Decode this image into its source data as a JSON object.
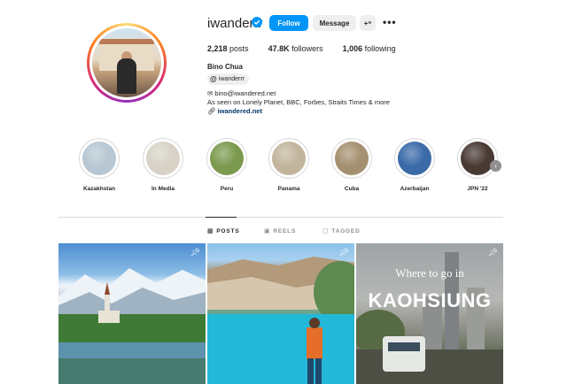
{
  "profile": {
    "username": "iwanderrr",
    "full_name": "Bino Chua",
    "threads_handle": "iwanderrr",
    "bio_email": "bino@iwandered.net",
    "bio_line2": "As seen on Lonely Planet, BBC, Forbes, Straits Times & more",
    "bio_link": "iwandered.net"
  },
  "actions": {
    "follow": "Follow",
    "message": "Message",
    "add_user": "+⁹",
    "more": "•••"
  },
  "stats": {
    "posts_count": "2,218",
    "posts_label": "posts",
    "followers_count": "47.8K",
    "followers_label": "followers",
    "following_count": "1,006",
    "following_label": "following"
  },
  "highlights": [
    {
      "label": "Kazakhstan",
      "color": "#b7c7d3"
    },
    {
      "label": "In Media",
      "color": "#d8d3c6"
    },
    {
      "label": "Peru",
      "color": "#7b9a4f"
    },
    {
      "label": "Panama",
      "color": "#c2b59c"
    },
    {
      "label": "Cuba",
      "color": "#a49070"
    },
    {
      "label": "Azerbaijan",
      "color": "#3a6aa8"
    },
    {
      "label": "JPN '22",
      "color": "#4a3a34"
    }
  ],
  "tabs": [
    {
      "label": "POSTS",
      "icon": "grid-icon",
      "glyph": "▦"
    },
    {
      "label": "REELS",
      "icon": "reels-icon",
      "glyph": "▣"
    },
    {
      "label": "TAGGED",
      "icon": "tagged-icon",
      "glyph": "▢"
    }
  ],
  "posts": [
    {
      "pinned": true
    },
    {
      "pinned": true
    },
    {
      "pinned": true,
      "title_line1": "Where to go in",
      "title_line2": "KAOHSIUNG"
    }
  ],
  "colors": {
    "accent": "#0095f6",
    "link": "#00376b"
  }
}
